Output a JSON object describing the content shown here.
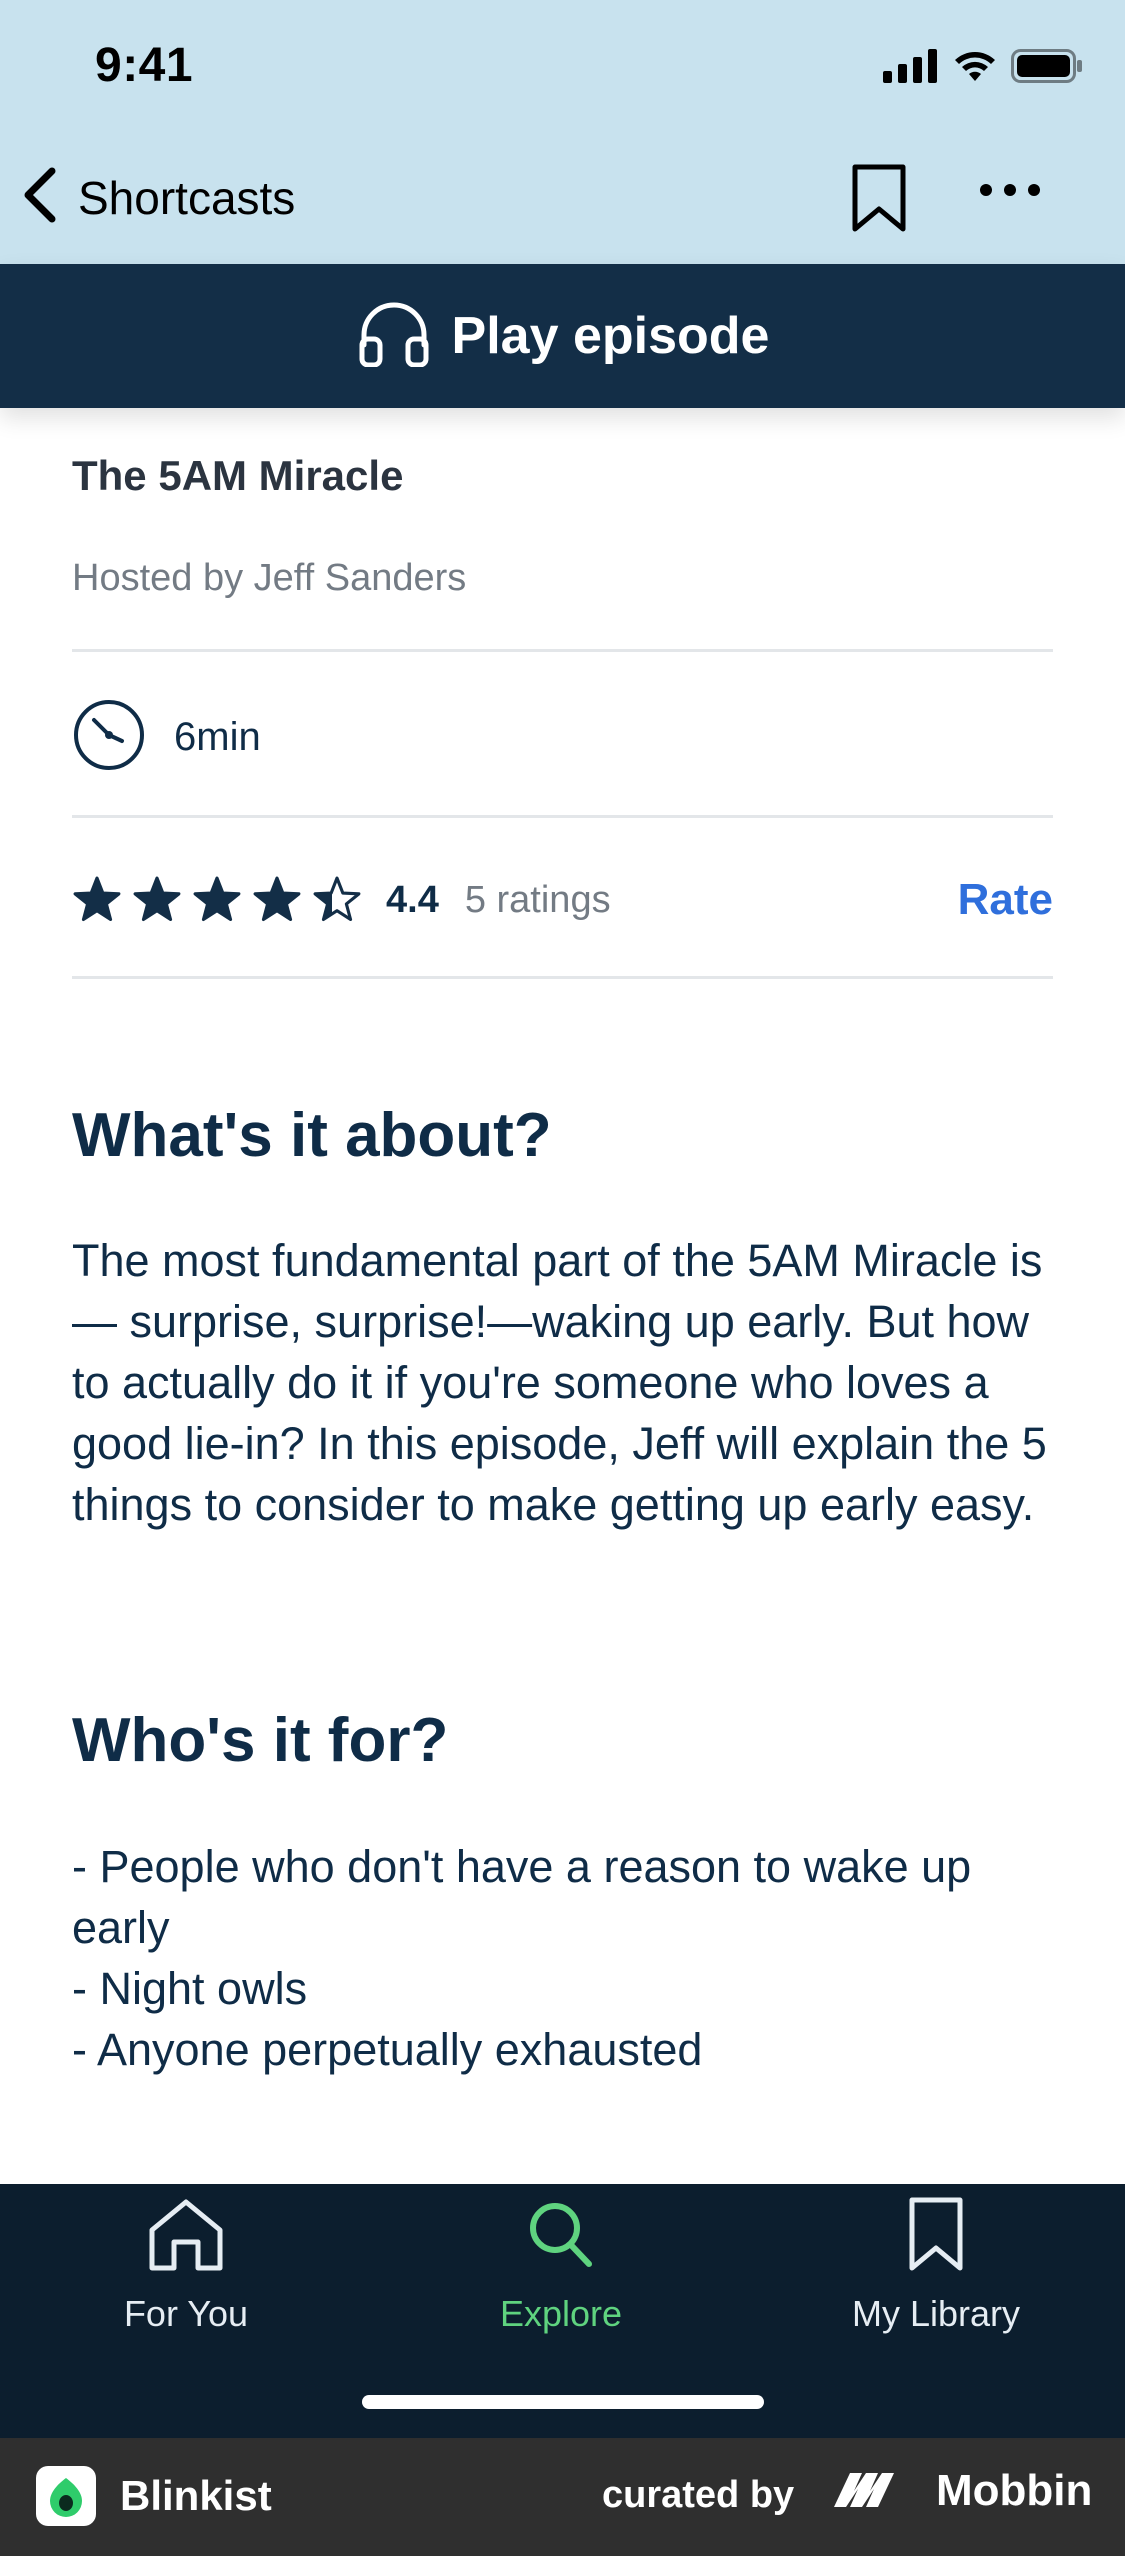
{
  "status": {
    "time": "9:41",
    "icons": [
      "signal-icon",
      "wifi-icon",
      "battery-icon"
    ]
  },
  "nav": {
    "back_label": "Shortcasts",
    "icons": [
      "chevron-left-icon",
      "bookmark-icon",
      "more-icon"
    ]
  },
  "play": {
    "label": "Play episode",
    "icon": "headphones-icon"
  },
  "episode": {
    "title": "The 5AM Miracle",
    "host": "Hosted by Jeff Sanders",
    "duration": "6min",
    "duration_icon": "clock-icon"
  },
  "rating": {
    "value": "4.4",
    "count": "5 ratings",
    "rate_label": "Rate",
    "stars": 4.4,
    "max_stars": 5
  },
  "about": {
    "heading": "What's it about?",
    "text": "The most fundamental part of the 5AM Miracle is— surprise, surprise!—waking up early. But how to actually do it if you're someone who loves a good lie-in? In this episode, Jeff will explain the 5 things to consider to make getting up early easy."
  },
  "audience": {
    "heading": "Who's it for?",
    "text": "- People who don't have a reason to wake up early\n- Night owls\n- Anyone perpetually exhausted"
  },
  "tabs": [
    {
      "label": "For You",
      "icon": "home-icon",
      "active": false
    },
    {
      "label": "Explore",
      "icon": "search-icon",
      "active": true
    },
    {
      "label": "My Library",
      "icon": "bookmark-icon",
      "active": false
    }
  ],
  "footer": {
    "app_name": "Blinkist",
    "curated_label": "curated by",
    "brand": "Mobbin"
  },
  "colors": {
    "top_bg": "#c8e2ee",
    "play_bar": "#132e47",
    "accent_link": "#2f6fdc",
    "active_tab": "#5fd37f",
    "tabbar_bg": "#0c1e2e"
  }
}
